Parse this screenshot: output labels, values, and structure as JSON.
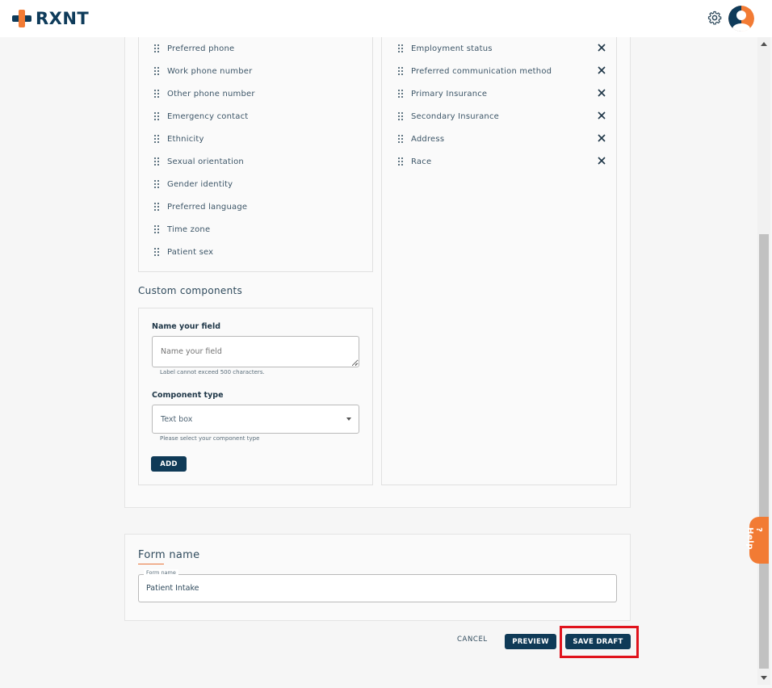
{
  "app": {
    "brand": "RXNT"
  },
  "left_fields": [
    "Preferred phone",
    "Work phone number",
    "Other phone number",
    "Emergency contact",
    "Ethnicity",
    "Sexual orientation",
    "Gender identity",
    "Preferred language",
    "Time zone",
    "Patient sex"
  ],
  "right_fields": [
    "Employment status",
    "Preferred communication method",
    "Primary Insurance",
    "Secondary Insurance",
    "Address",
    "Race"
  ],
  "custom": {
    "heading": "Custom components",
    "name_label": "Name your field",
    "name_placeholder": "Name your field",
    "name_helper": "Label cannot exceed 500 characters.",
    "type_label": "Component type",
    "type_value": "Text box",
    "type_helper": "Please select your component type",
    "add_label": "ADD"
  },
  "form": {
    "heading": "Form name",
    "legend": "Form name",
    "value": "Patient Intake"
  },
  "actions": {
    "cancel": "CANCEL",
    "preview": "PREVIEW",
    "save_draft": "SAVE DRAFT"
  },
  "help": {
    "label": "? Help"
  },
  "colors": {
    "brand_navy": "#0f3a57",
    "brand_orange": "#f27b34",
    "highlight_red": "#e0131c"
  },
  "icons": {
    "drag": "drag-handle-icon",
    "remove": "close-icon",
    "settings": "gear-icon",
    "user": "avatar-icon"
  }
}
